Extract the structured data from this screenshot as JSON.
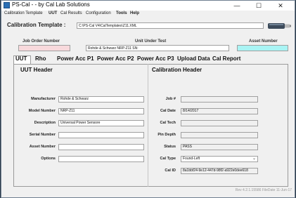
{
  "window": {
    "title": "PS-Cal - - by Cal Lab Solutions",
    "minimize": "—",
    "maximize": "☐",
    "close": "✕"
  },
  "menu": [
    "Calibration Template",
    "UUT",
    "Cal Results",
    "Configuration",
    "Tools",
    "Help"
  ],
  "calibration_template": {
    "label": "Calibration Template :",
    "value": "C:\\PS-Cal V4\\CalTemplates\\Z11.XML"
  },
  "header_fields": {
    "job_order_label": "Job Order Number",
    "job_order_value": "",
    "uut_label": "Unit Under Test",
    "uut_value": "Rohde & Schwarz NRP-Z11 SN:",
    "asset_label": "Asset Number",
    "asset_value": ""
  },
  "tabs": [
    "UUT",
    "Rho",
    "Power Acc P1",
    "Power Acc P2",
    "Power Acc P3",
    "Upload Data",
    "Cal Report"
  ],
  "uut_header": {
    "title": "UUT Header",
    "fields": [
      {
        "label": "Manufacturer",
        "value": "Rohde & Schwarz"
      },
      {
        "label": "Model Number",
        "value": "NRP-Z11"
      },
      {
        "label": "Description",
        "value": "Universal Power Sensore"
      },
      {
        "label": "Serial Number",
        "value": ""
      },
      {
        "label": "Asset Number",
        "value": ""
      },
      {
        "label": "Options",
        "value": ""
      }
    ]
  },
  "calibration_header": {
    "title": "Calibration Header",
    "fields": [
      {
        "label": "Job #",
        "value": ""
      },
      {
        "label": "Cal Date",
        "value": "8/14/2017"
      },
      {
        "label": "Cal Tech",
        "value": ""
      },
      {
        "label": "Pin Depth",
        "value": ""
      },
      {
        "label": "Status",
        "value": "PASS"
      },
      {
        "label": "Cal Type",
        "value": "Found-Left"
      },
      {
        "label": "Cal ID",
        "value": "8a1bbf24-9e12-447d-98f2-a922e0dee618"
      }
    ]
  },
  "status_bar": "Rev 4.2.1.15586 FileDate 11-Jun-17",
  "colors": {
    "job_order_bg": "#f8d9dc",
    "asset_bg": "#a9f4f4",
    "panel_bg": "#f0f0f0"
  }
}
